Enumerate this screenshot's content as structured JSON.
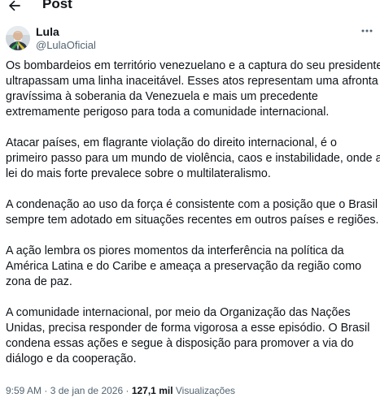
{
  "header": {
    "back_icon": "back-arrow-icon",
    "title": "Post"
  },
  "author": {
    "avatar_icon": "avatar",
    "display_name": "Lula",
    "handle": "@LulaOficial",
    "more_icon": "more-horizontal-icon"
  },
  "post": {
    "paragraphs": [
      [
        "Os bombardeios em território venezuelano e a captura do seu presidente",
        "ultrapassam uma linha inaceitável. Esses atos representam uma afronta",
        "gravíssima à soberania da Venezuela e mais um precedente",
        "extremamente perigoso para toda a comunidade internacional."
      ],
      [
        "Atacar países, em flagrante violação do direito internacional, é o",
        "primeiro passo para um mundo de violência, caos e instabilidade, onde a",
        "lei do mais forte prevalece sobre o multilateralismo."
      ],
      [
        "A condenação ao uso da força é consistente com a posição que o Brasil",
        "sempre tem adotado em situações recentes em outros países e regiões."
      ],
      [
        "A ação lembra os piores momentos da interferência na política da",
        "América Latina e do Caribe e ameaça a preservação da região como",
        "zona de paz."
      ],
      [
        "A comunidade internacional, por meio da Organização das Nações",
        "Unidas, precisa responder de forma vigorosa a esse episódio. O Brasil",
        "condena essas ações e segue à disposição para promover a via do",
        "diálogo e da cooperação."
      ]
    ]
  },
  "meta": {
    "time": "9:59 AM",
    "separator": "·",
    "date": "3 de jan de 2026",
    "views_count": "127,1 mil",
    "views_label": "Visualizações"
  },
  "colors": {
    "text": "#0f1419",
    "secondary": "#536471",
    "background": "#ffffff"
  }
}
